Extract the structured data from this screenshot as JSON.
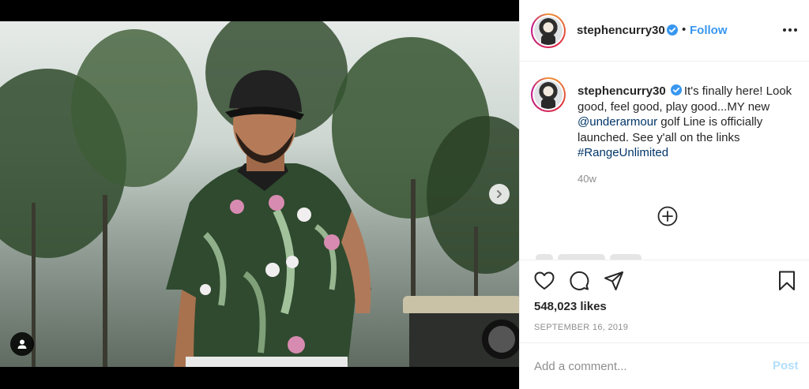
{
  "post": {
    "username": "stephencurry30",
    "follow_label": "Follow",
    "header_dot": "•",
    "caption": {
      "text_part1": "It's finally here! Look good, feel good, play good...MY new ",
      "mention": "@underarmour",
      "text_part2": " golf Line is officially launched. See y'all on the links ",
      "hashtag": "#RangeUnlimited"
    },
    "age": "40w",
    "likes": "548,023 likes",
    "date": "September 16, 2019"
  },
  "comment_box": {
    "placeholder": "Add a comment...",
    "post_label": "Post"
  },
  "colors": {
    "link_blue": "#3897f0",
    "post_disabled": "#b2dffc",
    "verified": "#3897f0",
    "meta_gray": "#8e8e8e"
  },
  "icons": [
    "verified-badge-icon",
    "more-options-icon",
    "heart-icon",
    "comment-icon",
    "share-icon",
    "bookmark-icon",
    "load-more-icon",
    "next-arrow-icon",
    "user-tag-icon"
  ]
}
